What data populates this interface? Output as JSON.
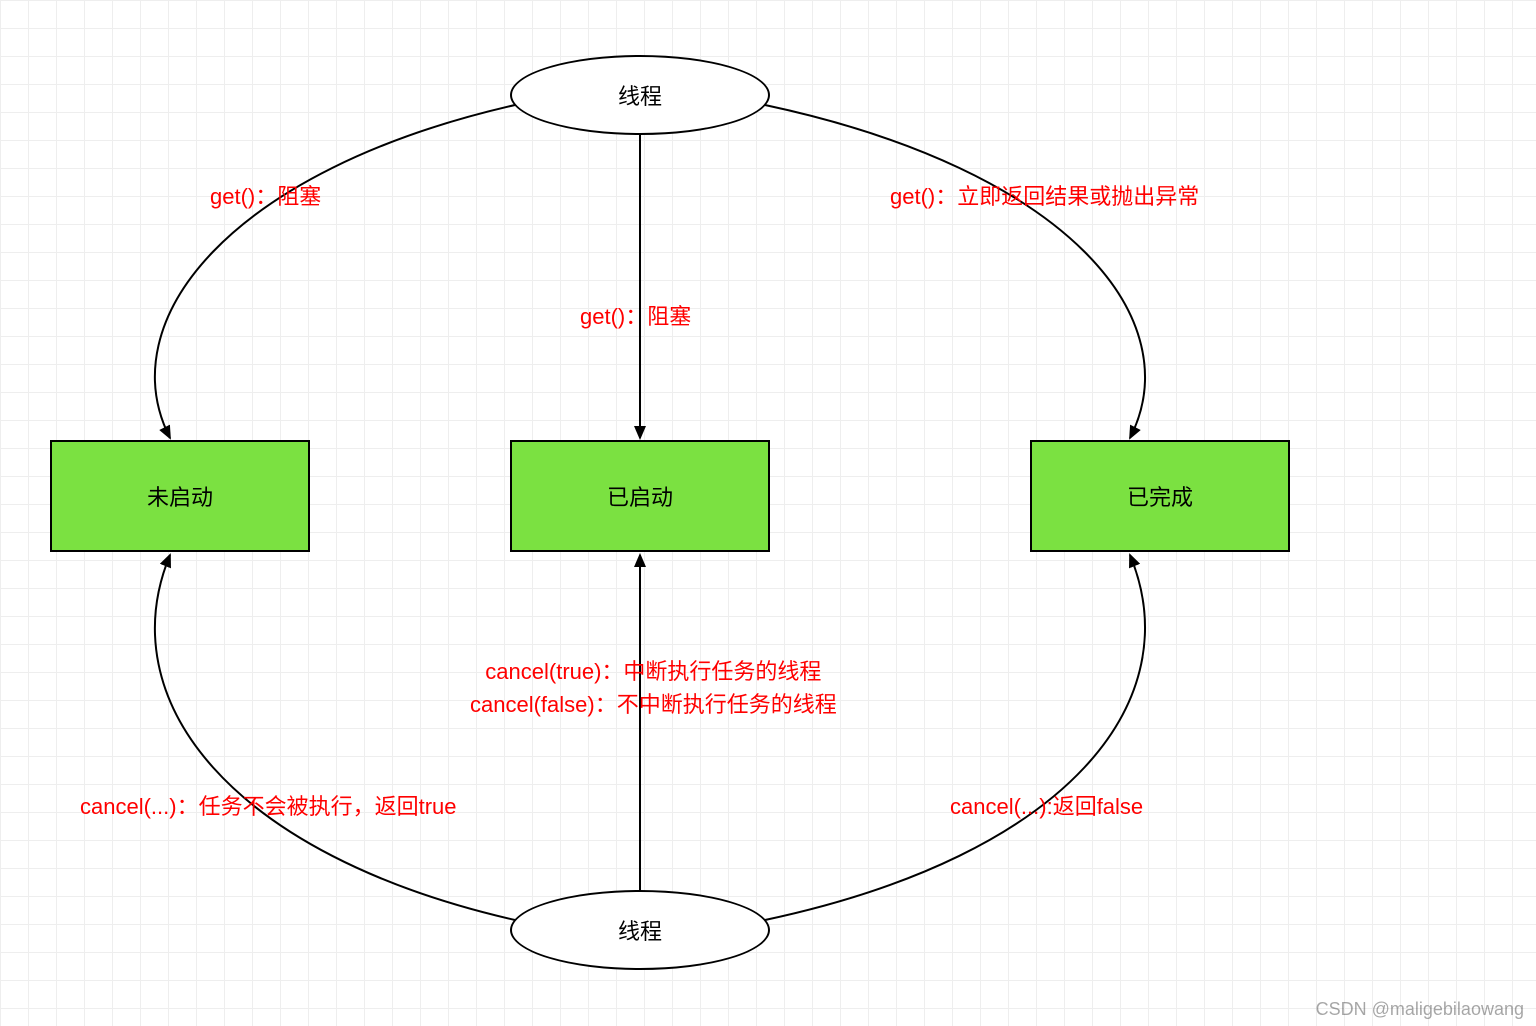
{
  "nodes": {
    "top_ellipse": "线程",
    "bottom_ellipse": "线程",
    "left_rect": "未启动",
    "middle_rect": "已启动",
    "right_rect": "已完成"
  },
  "edge_labels": {
    "top_left": "get()：阻塞",
    "top_middle": "get()：阻塞",
    "top_right": "get()：立即返回结果或抛出异常",
    "bottom_left": "cancel(...)：任务不会被执行，返回true",
    "bottom_middle_line1": "cancel(true)：中断执行任务的线程",
    "bottom_middle_line2": "cancel(false)：不中断执行任务的线程",
    "bottom_right": "cancel(...):返回false"
  },
  "watermark": "CSDN @maligebilaowang",
  "colors": {
    "state_fill": "#7be141",
    "label_text": "#ff0000",
    "stroke": "#000000"
  }
}
